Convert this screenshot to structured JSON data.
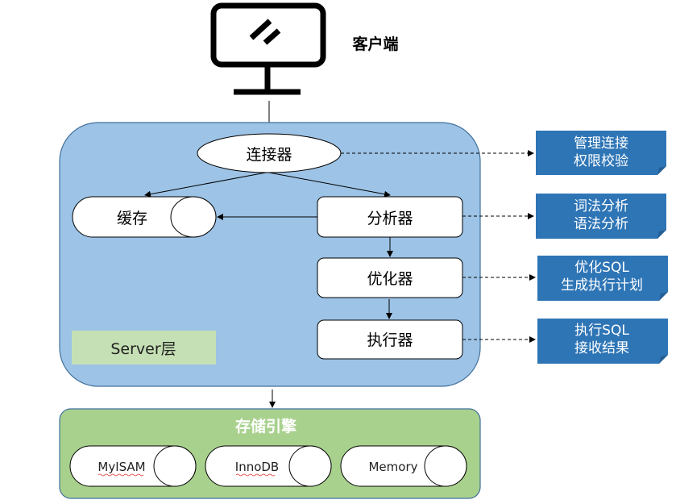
{
  "client": {
    "label": "客户端",
    "icon": "monitor-icon"
  },
  "server_layer": {
    "label": "Server层",
    "fill": "#9DC3E6",
    "border": "#41719C",
    "label_fill": "#C5E0B4",
    "components": {
      "connector": "连接器",
      "cache": "缓存",
      "analyzer": "分析器",
      "optimizer": "优化器",
      "executor": "执行器"
    }
  },
  "notes": [
    {
      "line1": "管理连接",
      "line2": "权限校验"
    },
    {
      "line1": "词法分析",
      "line2": "语法分析"
    },
    {
      "line1": "优化SQL",
      "line2": "生成执行计划"
    },
    {
      "line1": "执行SQL",
      "line2": "接收结果"
    }
  ],
  "note_color": "#2E75B6",
  "storage_layer": {
    "title": "存储引擎",
    "fill": "#A9D18E",
    "border": "#41719C",
    "engines": [
      "MyISAM",
      "InnoDB",
      "Memory"
    ]
  }
}
